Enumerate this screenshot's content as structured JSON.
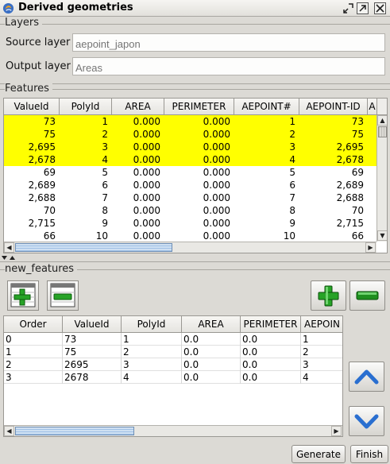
{
  "window": {
    "title": "Derived geometries"
  },
  "layers": {
    "section_label": "Layers",
    "source_label": "Source layer",
    "source_placeholder": "aepoint_japon",
    "output_label": "Output layer",
    "output_placeholder": "Areas"
  },
  "features": {
    "section_label": "Features",
    "columns": [
      "ValueId",
      "PolyId",
      "AREA",
      "PERIMETER",
      "AEPOINT#",
      "AEPOINT-ID",
      "A"
    ],
    "rows": [
      {
        "selected": true,
        "cells": [
          "73",
          "1",
          "0.000",
          "0.000",
          "1",
          "73"
        ]
      },
      {
        "selected": true,
        "cells": [
          "75",
          "2",
          "0.000",
          "0.000",
          "2",
          "75"
        ]
      },
      {
        "selected": true,
        "cells": [
          "2,695",
          "3",
          "0.000",
          "0.000",
          "3",
          "2,695"
        ]
      },
      {
        "selected": true,
        "cells": [
          "2,678",
          "4",
          "0.000",
          "0.000",
          "4",
          "2,678"
        ]
      },
      {
        "selected": false,
        "cells": [
          "69",
          "5",
          "0.000",
          "0.000",
          "5",
          "69"
        ]
      },
      {
        "selected": false,
        "cells": [
          "2,689",
          "6",
          "0.000",
          "0.000",
          "6",
          "2,689"
        ]
      },
      {
        "selected": false,
        "cells": [
          "2,688",
          "7",
          "0.000",
          "0.000",
          "7",
          "2,688"
        ]
      },
      {
        "selected": false,
        "cells": [
          "70",
          "8",
          "0.000",
          "0.000",
          "8",
          "70"
        ]
      },
      {
        "selected": false,
        "cells": [
          "2,715",
          "9",
          "0.000",
          "0.000",
          "9",
          "2,715"
        ]
      },
      {
        "selected": false,
        "cells": [
          "66",
          "10",
          "0.000",
          "0.000",
          "10",
          "66"
        ]
      }
    ]
  },
  "new_features": {
    "section_label": "new_features",
    "columns": [
      "Order",
      "ValueId",
      "PolyId",
      "AREA",
      "PERIMETER",
      "AEPOIN"
    ],
    "rows": [
      [
        "0",
        "73",
        "1",
        "0.0",
        "0.0",
        "1"
      ],
      [
        "1",
        "75",
        "2",
        "0.0",
        "0.0",
        "2"
      ],
      [
        "2",
        "2695",
        "3",
        "0.0",
        "0.0",
        "3"
      ],
      [
        "3",
        "2678",
        "4",
        "0.0",
        "0.0",
        "4"
      ]
    ]
  },
  "buttons": {
    "generate": "Generate",
    "finish": "Finish"
  },
  "colors": {
    "selection": "#ffff00",
    "add_green": "#27a327",
    "remove_green": "#1f8f1f",
    "arrow_blue": "#2a6fd0"
  },
  "icons": {
    "app": "app-icon",
    "restore": "restore-icon",
    "maximize": "maximize-icon",
    "close": "close-icon",
    "add_table": "add-table-icon",
    "remove_table": "remove-table-icon",
    "add": "plus-icon",
    "remove": "minus-icon",
    "move_up": "chevron-up-icon",
    "move_down": "chevron-down-icon"
  }
}
